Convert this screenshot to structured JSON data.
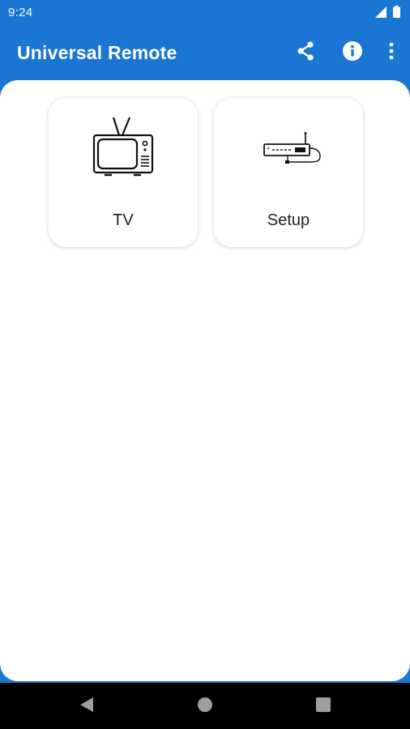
{
  "status_bar": {
    "time": "9:24",
    "icons": [
      "cellular-signal-icon",
      "battery-icon"
    ]
  },
  "app_bar": {
    "title": "Universal Remote",
    "actions": [
      "share-icon",
      "info-icon",
      "more-vert-icon"
    ]
  },
  "tiles": [
    {
      "label": "TV",
      "icon": "tv-icon"
    },
    {
      "label": "Setup",
      "icon": "set-top-box-icon"
    }
  ],
  "nav_bar": {
    "buttons": [
      "back-icon",
      "home-icon",
      "recents-icon"
    ]
  },
  "colors": {
    "primary": "#1976d2",
    "surface": "#ffffff",
    "nav_background": "#000000",
    "icon_gray": "#9e9e9e"
  }
}
